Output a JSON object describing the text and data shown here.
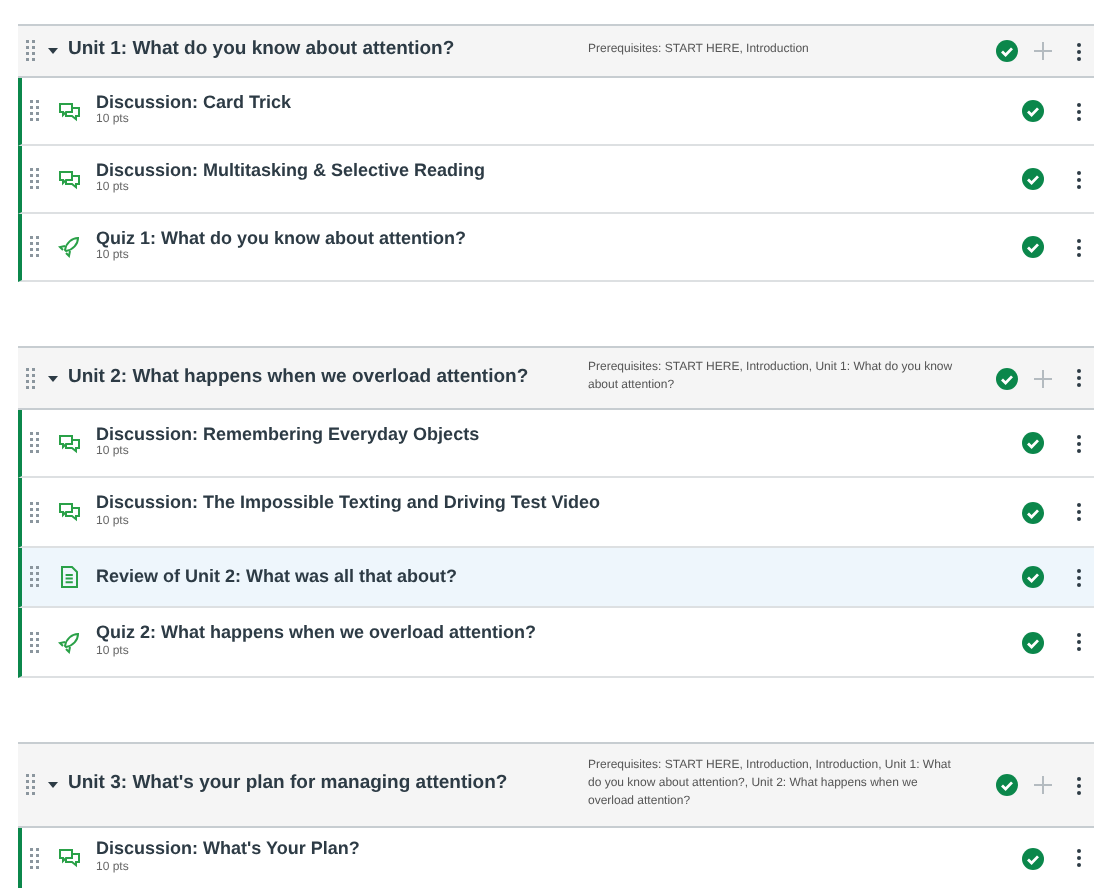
{
  "modules": [
    {
      "title": "Unit 1: What do you know about attention?",
      "expanded": true,
      "prerequisites": "Prerequisites: START HERE, Introduction",
      "published": true,
      "items": [
        {
          "kind": "discussion",
          "title": "Discussion: Card Trick",
          "points": "10 pts",
          "published": true,
          "highlighted": false
        },
        {
          "kind": "discussion",
          "title": "Discussion: Multitasking & Selective Reading",
          "points": "10 pts",
          "published": true,
          "highlighted": false
        },
        {
          "kind": "quiz",
          "title": "Quiz 1: What do you know about attention?",
          "points": "10 pts",
          "published": true,
          "highlighted": false
        }
      ]
    },
    {
      "title": "Unit 2: What happens when we overload attention?",
      "expanded": true,
      "prerequisites": "Prerequisites: START HERE, Introduction, Unit 1: What do you know about attention?",
      "published": true,
      "items": [
        {
          "kind": "discussion",
          "title": "Discussion: Remembering Everyday Objects",
          "points": "10 pts",
          "published": true,
          "highlighted": false
        },
        {
          "kind": "discussion",
          "title": "Discussion: The Impossible Texting and Driving Test Video",
          "points": "10 pts",
          "published": true,
          "highlighted": false
        },
        {
          "kind": "page",
          "title": "Review of Unit 2: What was all that about?",
          "published": true,
          "highlighted": true
        },
        {
          "kind": "quiz",
          "title": "Quiz 2: What happens when we overload attention?",
          "points": "10 pts",
          "published": true,
          "highlighted": false
        }
      ]
    },
    {
      "title": "Unit 3: What's your plan for managing attention?",
      "expanded": true,
      "prerequisites": "Prerequisites: START HERE, Introduction, Introduction, Unit 1: What do you know about attention?, Unit 2: What happens when we overload attention?",
      "published": true,
      "items": [
        {
          "kind": "discussion",
          "title": "Discussion: What's Your Plan?",
          "points": "10 pts",
          "published": true,
          "highlighted": false
        }
      ]
    }
  ]
}
